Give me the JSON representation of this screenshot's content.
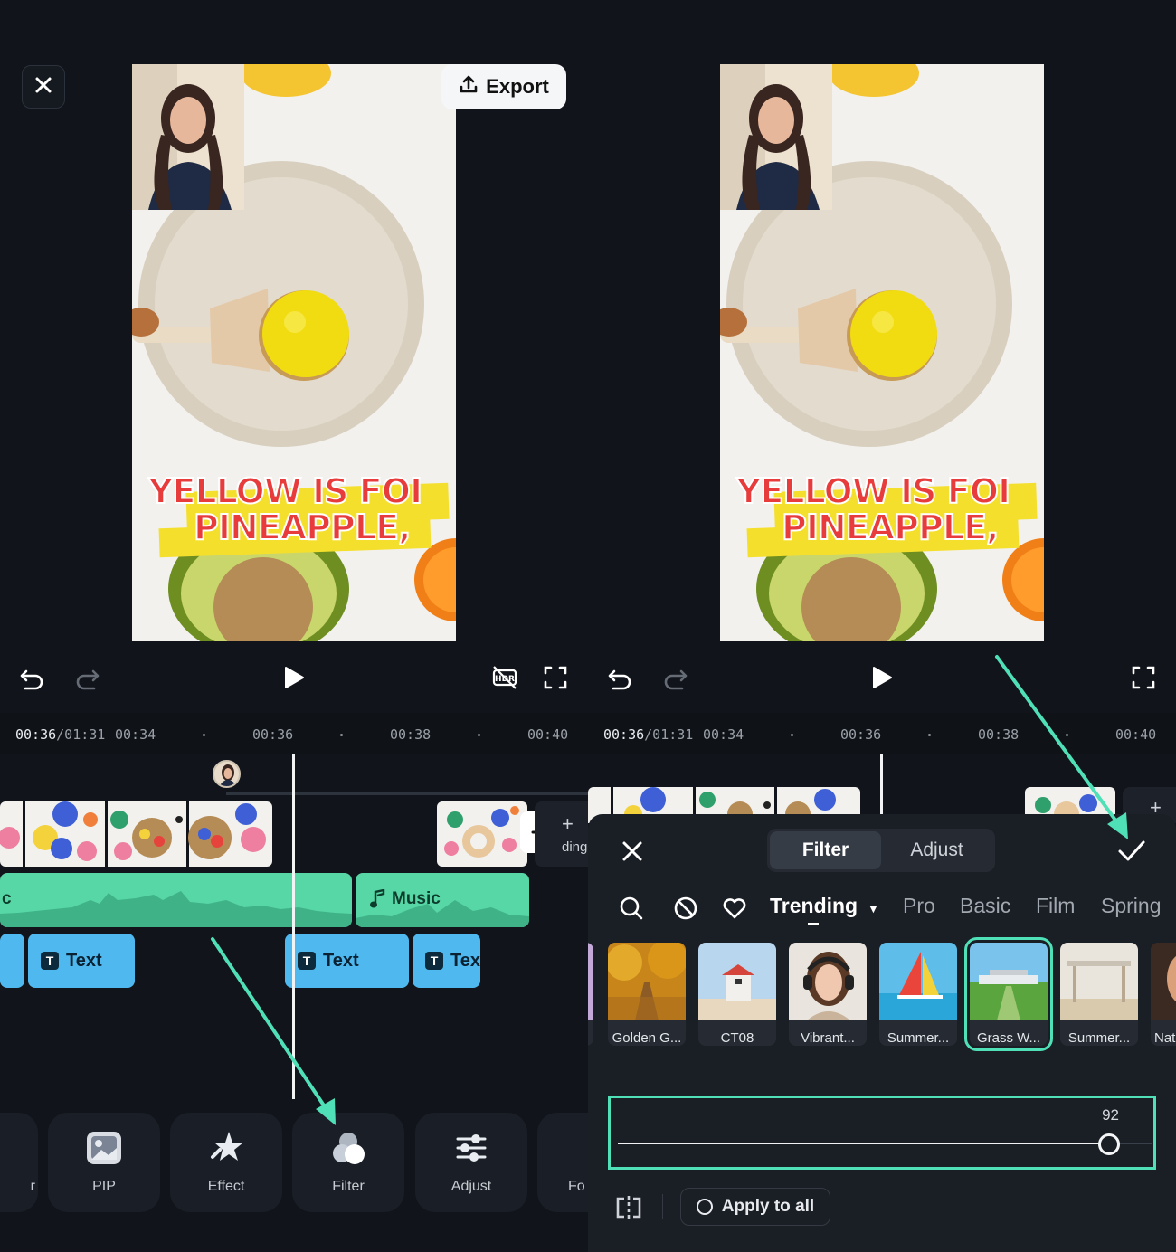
{
  "left_screen": {
    "export_label": "Export",
    "timeline": {
      "current_time": "00:36",
      "total_time": "/01:31",
      "ticks": [
        "00:34",
        "00:36",
        "00:38",
        "00:40"
      ]
    },
    "tracks": {
      "audio_left_label": "c",
      "audio_music_label": "Music",
      "text_clips": [
        "Text",
        "Text",
        "Tex"
      ],
      "add_clip_partial_text": "ding"
    },
    "toolbar": [
      "r",
      "PIP",
      "Effect",
      "Filter",
      "Adjust",
      "Fo"
    ]
  },
  "right_screen": {
    "timeline": {
      "current_time": "00:36",
      "total_time": "/01:31",
      "ticks": [
        "00:34",
        "00:36",
        "00:38",
        "00:40"
      ]
    },
    "filter_sheet": {
      "tabs": [
        "Filter",
        "Adjust"
      ],
      "active_tab": "Filter",
      "categories": [
        "Trending",
        "Pro",
        "Basic",
        "Film",
        "Spring"
      ],
      "active_category": "Trending",
      "filters": [
        {
          "name": "Golden G...",
          "selected": false
        },
        {
          "name": "CT08",
          "selected": false
        },
        {
          "name": "Vibrant...",
          "selected": false
        },
        {
          "name": "Summer...",
          "selected": false
        },
        {
          "name": "Grass W...",
          "selected": true
        },
        {
          "name": "Summer...",
          "selected": false
        },
        {
          "name": "Nat",
          "selected": false
        }
      ],
      "intensity_value": "92",
      "intensity_fraction": 0.92,
      "apply_all_label": "Apply to all"
    }
  },
  "video_caption": {
    "line1": "YELLOW IS FOI",
    "line2": "PINEAPPLE,"
  },
  "colors": {
    "background": "#11141a",
    "accent_teal": "#4fe0b8",
    "audio_track": "#57d6a6",
    "text_track": "#4fb8ee",
    "caption_fill": "#ffe24a",
    "caption_text": "#e83b3b"
  }
}
